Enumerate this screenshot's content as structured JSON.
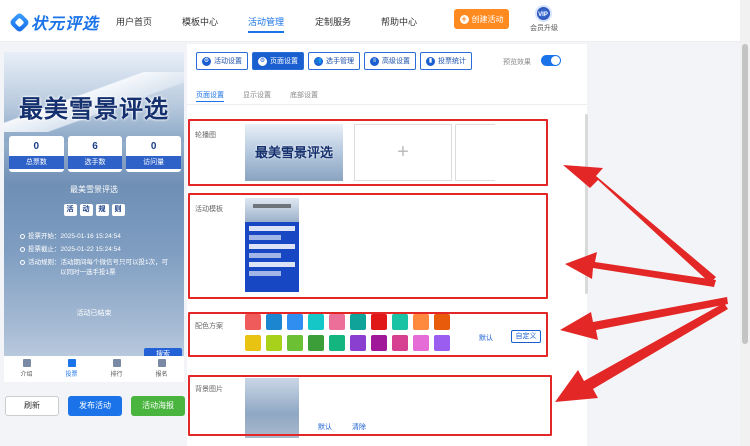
{
  "app": {
    "logo_text": "状元评选"
  },
  "nav": [
    {
      "label": "用户首页",
      "active": false
    },
    {
      "label": "模板中心",
      "active": false
    },
    {
      "label": "活动管理",
      "active": true
    },
    {
      "label": "定制服务",
      "active": false
    },
    {
      "label": "帮助中心",
      "active": false
    }
  ],
  "header": {
    "create_label": "创建活动",
    "vip_badge": "VIP",
    "vip_label": "会员升级"
  },
  "preview": {
    "title": "最美雪景评选",
    "stats": [
      {
        "value": "0",
        "label": "总票数"
      },
      {
        "value": "6",
        "label": "选手数"
      },
      {
        "value": "0",
        "label": "访问量"
      }
    ],
    "activity_name": "最美雪景评选",
    "rule_chips": [
      "活",
      "动",
      "规",
      "则"
    ],
    "vote_start": "投票开始：2025-01-16 15:24:54",
    "vote_end": "投票截止：2025-01-22 15:24:54",
    "rule_line1": "活动规则：活动期间每个微信号只可以投1次，可",
    "rule_line2": "以同时一选手投1票",
    "ended": "活动已结束",
    "search_label": "搜索",
    "tabs": [
      {
        "label": "介绍",
        "icon": "doc-icon"
      },
      {
        "label": "投票",
        "icon": "flag-icon"
      },
      {
        "label": "排行",
        "icon": "bar-chart-icon"
      },
      {
        "label": "报名",
        "icon": "hand-icon"
      }
    ]
  },
  "actions": {
    "refresh": "刷新",
    "publish": "发布活动",
    "poster": "活动海报"
  },
  "toolbar": [
    {
      "label": "活动设置",
      "icon": "gear-icon",
      "active": false
    },
    {
      "label": "页面设置",
      "icon": "gear-icon",
      "active": true
    },
    {
      "label": "选手管理",
      "icon": "users-icon",
      "active": false
    },
    {
      "label": "高级设置",
      "icon": "settings-icon",
      "active": false
    },
    {
      "label": "投票统计",
      "icon": "chart-icon",
      "active": false
    }
  ],
  "preview_toggle_label": "预览效果",
  "preview_toggle_on": true,
  "subtabs": [
    {
      "label": "页面设置",
      "active": true
    },
    {
      "label": "显示设置",
      "active": false
    },
    {
      "label": "底部设置",
      "active": false
    }
  ],
  "sections": {
    "carousel": "轮播图",
    "carousel_image_text": "最美雪景评选",
    "template": "活动模板",
    "color_scheme": "配色方案",
    "background": "背景图片"
  },
  "swatches_row1": [
    "#ef5a5a",
    "#1c86d1",
    "#2f8ef0",
    "#15c7c7",
    "#ec6f9a",
    "#0fa39a",
    "#e01818",
    "#19c3a3",
    "#ff8a3d",
    "#e85b0b"
  ],
  "swatches_row2": [
    "#e9c312",
    "#a8d11b",
    "#6cc033",
    "#3c9e39",
    "#14b57e",
    "#8a3fd1",
    "#a0179a",
    "#d63f8f",
    "#e56bd6",
    "#9b5cf0"
  ],
  "color_default": "默认",
  "color_custom": "自定义",
  "bg_default": "默认",
  "bg_clear": "清除"
}
